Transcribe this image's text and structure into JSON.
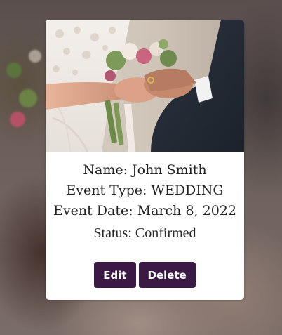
{
  "card": {
    "name_line": "Name: John Smith",
    "event_type_line": "Event Type: WEDDING",
    "event_date_line": "Event Date: March 8, 2022",
    "status_line": "Status: Confirmed",
    "edit_label": "Edit",
    "delete_label": "Delete"
  },
  "colors": {
    "button_bg": "#3a1a45",
    "card_bg": "#ffffff",
    "text": "#222222"
  },
  "icons": {
    "photo": "wedding-ring-photo",
    "background": "wedding-background-photo"
  }
}
